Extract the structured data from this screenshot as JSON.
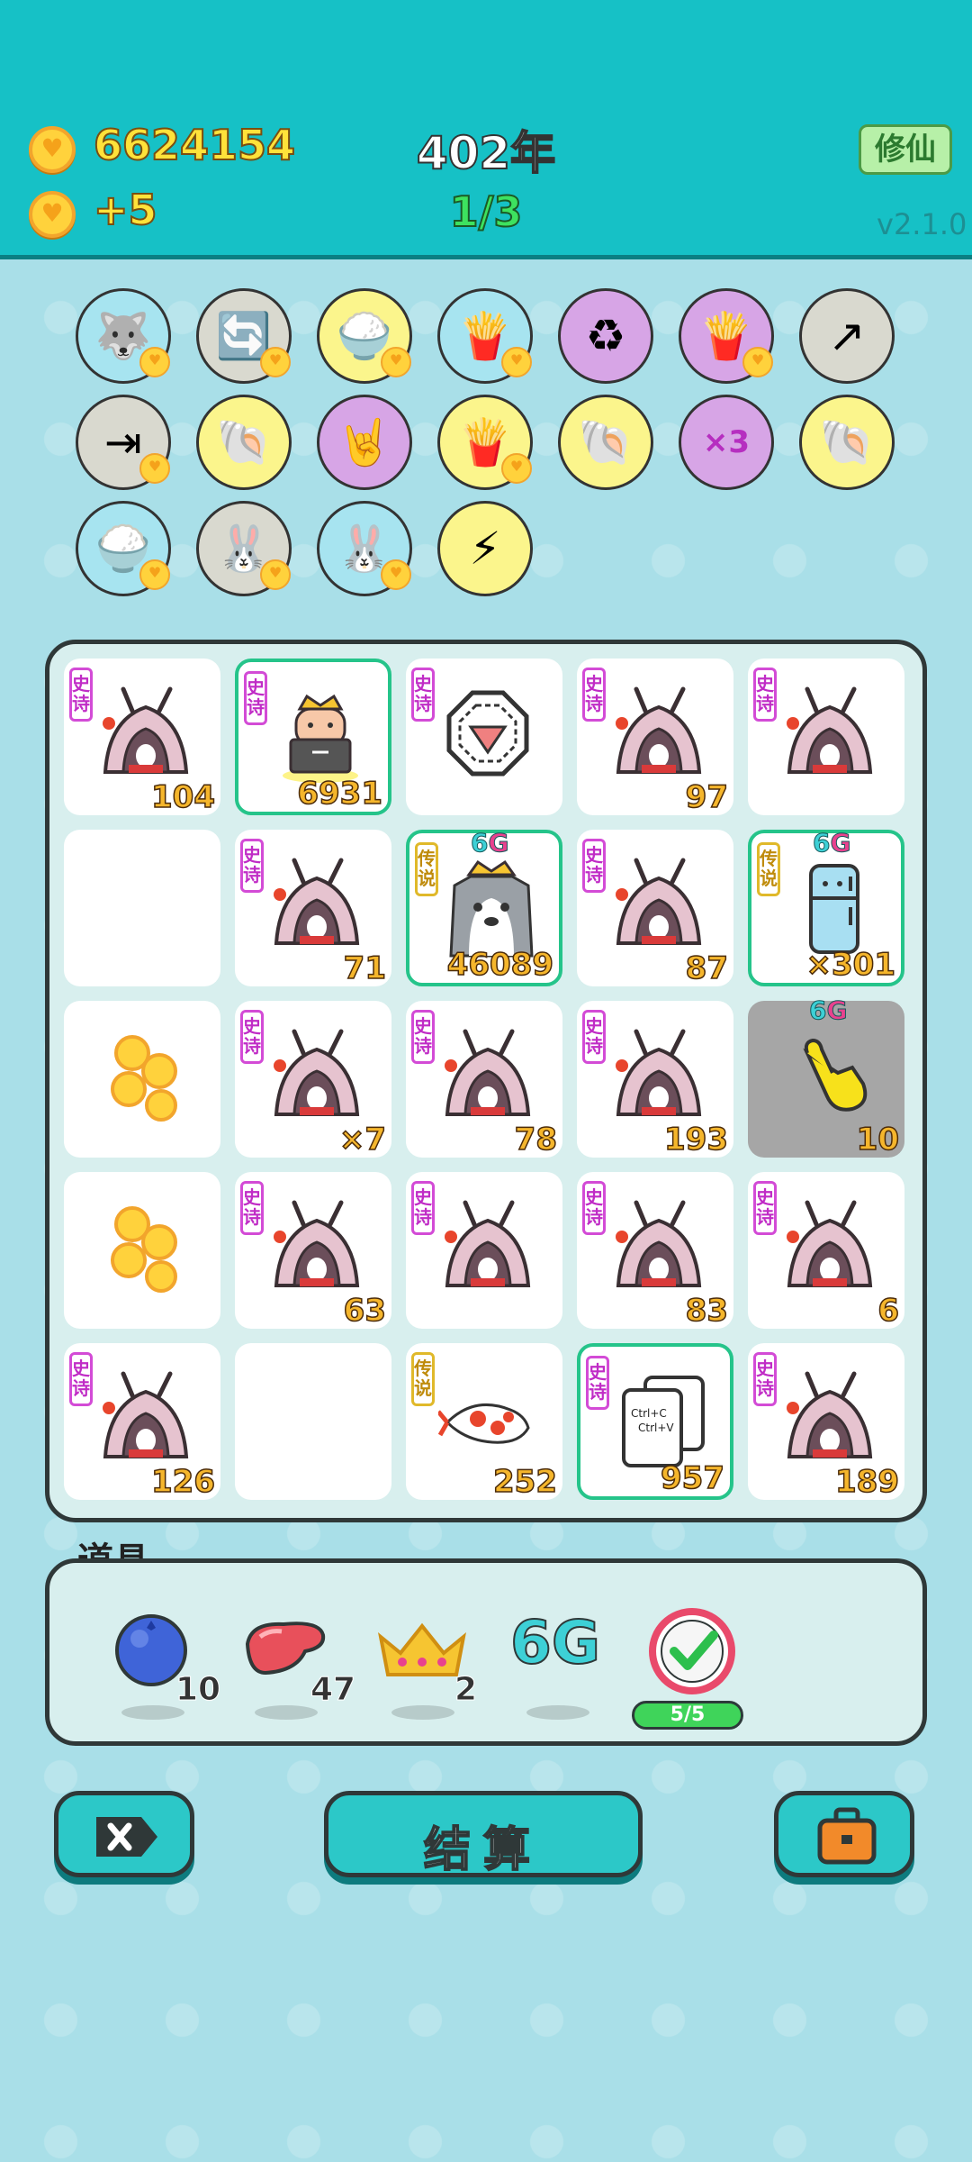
{
  "header": {
    "coins": "6624154",
    "coin_income": "+5",
    "year": "402年",
    "round": "1/3",
    "cultivate_label": "修仙",
    "version": "v2.1.0"
  },
  "symbols": [
    {
      "icon": "husky-dog-icon",
      "glyph": "🐺",
      "bg": "#a7e4f0",
      "heart": true
    },
    {
      "icon": "recycle-arrows-icon",
      "glyph": "🔄",
      "bg": "#d9d9cf",
      "heart": true
    },
    {
      "icon": "rice-bowl-icon",
      "glyph": "🍚",
      "bg": "#fbf58c",
      "heart": true
    },
    {
      "icon": "fries-icon",
      "glyph": "🍟",
      "bg": "#a7e4f0",
      "heart": true
    },
    {
      "icon": "recycle-symbol-icon",
      "glyph": "♻",
      "bg": "#d7a5e6",
      "heart": false
    },
    {
      "icon": "fries-icon",
      "glyph": "🍟",
      "bg": "#d7a5e6",
      "heart": true
    },
    {
      "icon": "share-arrow-icon",
      "glyph": "↗",
      "bg": "#d9d9cf",
      "heart": false
    },
    {
      "icon": "skip-icon",
      "glyph": "⇥",
      "bg": "#d9d9cf",
      "heart": true
    },
    {
      "icon": "shell-icon",
      "glyph": "🐚",
      "bg": "#fbf58c",
      "heart": false
    },
    {
      "icon": "rock-hand-icon",
      "glyph": "🤘",
      "bg": "#d7a5e6",
      "heart": false
    },
    {
      "icon": "fries-icon",
      "glyph": "🍟",
      "bg": "#fbf58c",
      "heart": true
    },
    {
      "icon": "shell-icon",
      "glyph": "🐚",
      "bg": "#fbf58c",
      "heart": false
    },
    {
      "icon": "multiplier-face-icon",
      "glyph": "×3",
      "bg": "#d7a5e6",
      "heart": false
    },
    {
      "icon": "shell-icon",
      "glyph": "🐚",
      "bg": "#fbf58c",
      "heart": false
    },
    {
      "icon": "rice-bowl-icon",
      "glyph": "🍚",
      "bg": "#a7e4f0",
      "heart": true
    },
    {
      "icon": "rabbit-icon",
      "glyph": "🐰",
      "bg": "#d9d9cf",
      "heart": true
    },
    {
      "icon": "rabbit-icon",
      "glyph": "🐰",
      "bg": "#a7e4f0",
      "heart": true
    },
    {
      "icon": "lightning-icon",
      "glyph": "⚡",
      "bg": "#fbf58c",
      "heart": false
    }
  ],
  "tags": {
    "epic": "史诗",
    "legend": "传说",
    "g6_prefix": "6",
    "g6_suffix": "G"
  },
  "board": [
    {
      "art": "rabbit-hut-icon",
      "tag": "epic",
      "count": "104"
    },
    {
      "art": "king-face-icon",
      "tag": "epic",
      "count": "6931",
      "hl": true
    },
    {
      "art": "bagua-icon",
      "tag": "epic",
      "count": ""
    },
    {
      "art": "rabbit-hut-icon",
      "tag": "epic",
      "count": "97"
    },
    {
      "art": "rabbit-hut-icon",
      "tag": "epic",
      "count": ""
    },
    {
      "art": "",
      "tag": "",
      "count": ""
    },
    {
      "art": "rabbit-hut-icon",
      "tag": "epic",
      "count": "71"
    },
    {
      "art": "husky-king-icon",
      "tag": "legend",
      "count": "46089",
      "hl": true,
      "g6": true
    },
    {
      "art": "rabbit-hut-icon",
      "tag": "epic",
      "count": "87"
    },
    {
      "art": "fridge-icon",
      "tag": "legend",
      "count": "×301",
      "hl": true,
      "g6": true
    },
    {
      "art": "coins-pile-icon",
      "tag": "",
      "count": ""
    },
    {
      "art": "rabbit-hut-icon",
      "tag": "epic",
      "count": "×7"
    },
    {
      "art": "rabbit-hut-icon",
      "tag": "epic",
      "count": "78"
    },
    {
      "art": "rabbit-hut-icon",
      "tag": "epic",
      "count": "193"
    },
    {
      "art": "pointing-hand-icon",
      "tag": "",
      "count": "10",
      "grey": true,
      "g6": true
    },
    {
      "art": "coins-pile-icon",
      "tag": "",
      "count": ""
    },
    {
      "art": "rabbit-hut-icon",
      "tag": "epic",
      "count": "63"
    },
    {
      "art": "rabbit-hut-icon",
      "tag": "epic",
      "count": ""
    },
    {
      "art": "rabbit-hut-icon",
      "tag": "epic",
      "count": "83"
    },
    {
      "art": "rabbit-hut-icon",
      "tag": "epic",
      "count": "6"
    },
    {
      "art": "rabbit-hut-icon",
      "tag": "epic",
      "count": "126"
    },
    {
      "art": "",
      "tag": "",
      "count": ""
    },
    {
      "art": "koi-fish-icon",
      "tag": "legend",
      "count": "252"
    },
    {
      "art": "ctrl-c-v-icon",
      "tag": "epic",
      "count": "957",
      "hl": true
    },
    {
      "art": "rabbit-hut-icon",
      "tag": "epic",
      "count": "189"
    }
  ],
  "items": {
    "title": "道具",
    "blueberry_count": "10",
    "liver_count": "47",
    "crown_count": "2",
    "g6_label": "6G",
    "check_progress": "5/5"
  },
  "buttons": {
    "settle_label": "结算"
  }
}
